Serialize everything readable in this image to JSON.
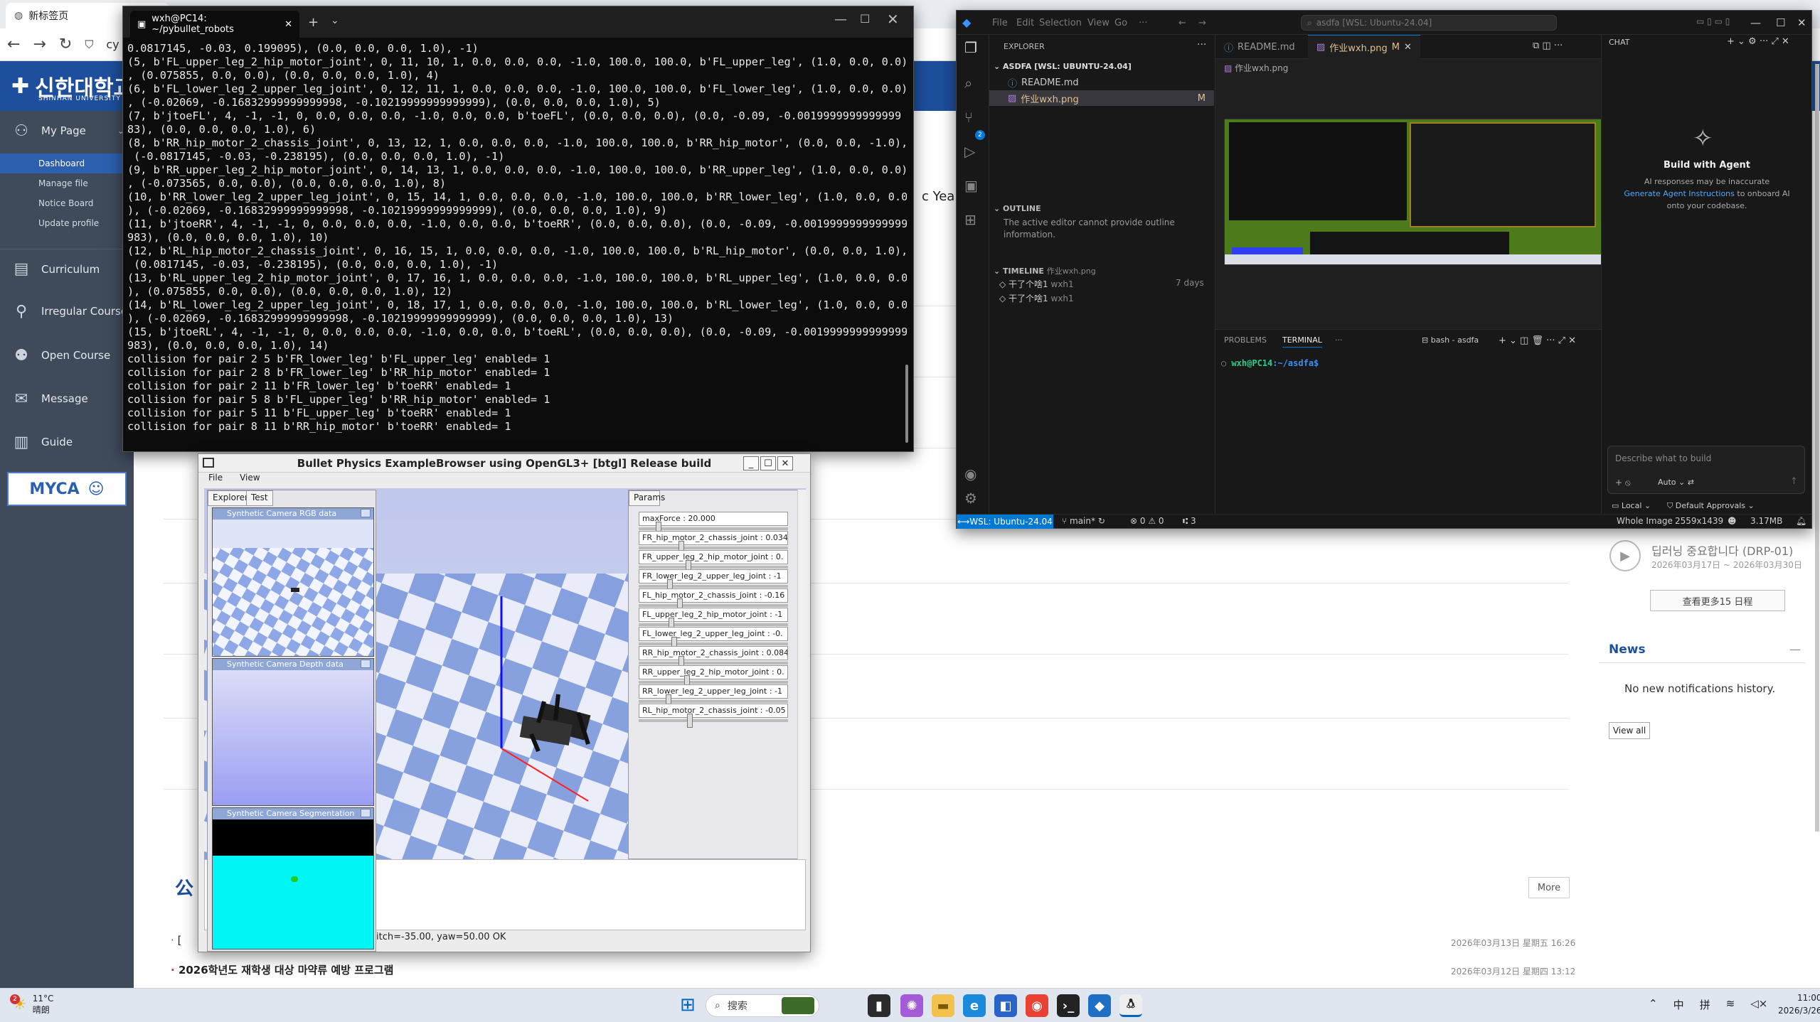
{
  "browser": {
    "tab_title": "新标签页",
    "url_fragment": "cy"
  },
  "portal": {
    "logo_text": "신한대학교",
    "logo_sub": "SHINHAN UNIVERSITY",
    "nav": [
      {
        "label": "My Page",
        "icon": "person-icon"
      },
      {
        "label": "Curriculum",
        "icon": "book-icon"
      },
      {
        "label": "Irregular Course",
        "icon": "person-run-icon"
      },
      {
        "label": "Open Course",
        "icon": "group-icon"
      },
      {
        "label": "Message",
        "icon": "mail-icon"
      },
      {
        "label": "Guide",
        "icon": "guide-icon"
      }
    ],
    "sub_nav": [
      "Dashboard",
      "Manage file",
      "Notice Board",
      "Update profile"
    ],
    "badge": "MYCA",
    "year_text": "c Year",
    "notice_heading": "公",
    "more_label": "More",
    "notices": [
      {
        "title": "[",
        "date": "2026年03月13日 星期五 16:26"
      },
      {
        "title": "2026학년도 재학생 대상 마약류 예방 프로그램",
        "date": "2026年03月12日 星期四 13:12"
      }
    ],
    "schedule_title": "딥러닝 중요합니다 (DRP-01)",
    "schedule_date": "2026年03月17日 ~ 2026年03月30日",
    "schedule_more": "查看更多15 日程",
    "news_title": "News",
    "news_empty": "No new notifications history.",
    "view_all": "View all"
  },
  "terminal": {
    "tab_title": "wxh@PC14: ~/pybullet_robots",
    "lines": [
      "0.0817145, -0.03, 0.199095), (0.0, 0.0, 0.0, 1.0), -1)",
      "(5, b'FL_upper_leg_2_hip_motor_joint', 0, 11, 10, 1, 0.0, 0.0, 0.0, -1.0, 100.0, 100.0, b'FL_upper_leg', (1.0, 0.0, 0.0)",
      ", (0.075855, 0.0, 0.0), (0.0, 0.0, 0.0, 1.0), 4)",
      "(6, b'FL_lower_leg_2_upper_leg_joint', 0, 12, 11, 1, 0.0, 0.0, 0.0, -1.0, 100.0, 100.0, b'FL_lower_leg', (1.0, 0.0, 0.0)",
      ", (-0.02069, -0.16832999999999998, -0.10219999999999999), (0.0, 0.0, 0.0, 1.0), 5)",
      "(7, b'jtoeFL', 4, -1, -1, 0, 0.0, 0.0, 0.0, -1.0, 0.0, 0.0, b'toeFL', (0.0, 0.0, 0.0), (0.0, -0.09, -0.0019999999999999",
      "83), (0.0, 0.0, 0.0, 1.0), 6)",
      "(8, b'RR_hip_motor_2_chassis_joint', 0, 13, 12, 1, 0.0, 0.0, 0.0, -1.0, 100.0, 100.0, b'RR_hip_motor', (0.0, 0.0, -1.0),",
      " (-0.0817145, -0.03, -0.238195), (0.0, 0.0, 0.0, 1.0), -1)",
      "(9, b'RR_upper_leg_2_hip_motor_joint', 0, 14, 13, 1, 0.0, 0.0, 0.0, -1.0, 100.0, 100.0, b'RR_upper_leg', (1.0, 0.0, 0.0)",
      ", (-0.073565, 0.0, 0.0), (0.0, 0.0, 0.0, 1.0), 8)",
      "(10, b'RR_lower_leg_2_upper_leg_joint', 0, 15, 14, 1, 0.0, 0.0, 0.0, -1.0, 100.0, 100.0, b'RR_lower_leg', (1.0, 0.0, 0.0",
      "), (-0.02069, -0.16832999999999998, -0.10219999999999999), (0.0, 0.0, 0.0, 1.0), 9)",
      "(11, b'jtoeRR', 4, -1, -1, 0, 0.0, 0.0, 0.0, -1.0, 0.0, 0.0, b'toeRR', (0.0, 0.0, 0.0), (0.0, -0.09, -0.0019999999999999",
      "983), (0.0, 0.0, 0.0, 1.0), 10)",
      "(12, b'RL_hip_motor_2_chassis_joint', 0, 16, 15, 1, 0.0, 0.0, 0.0, -1.0, 100.0, 100.0, b'RL_hip_motor', (0.0, 0.0, 1.0),",
      " (0.0817145, -0.03, -0.238195), (0.0, 0.0, 0.0, 1.0), -1)",
      "(13, b'RL_upper_leg_2_hip_motor_joint', 0, 17, 16, 1, 0.0, 0.0, 0.0, -1.0, 100.0, 100.0, b'RL_upper_leg', (1.0, 0.0, 0.0",
      "), (0.075855, 0.0, 0.0), (0.0, 0.0, 0.0, 1.0), 12)",
      "(14, b'RL_lower_leg_2_upper_leg_joint', 0, 18, 17, 1, 0.0, 0.0, 0.0, -1.0, 100.0, 100.0, b'RL_lower_leg', (1.0, 0.0, 0.0",
      "), (-0.02069, -0.16832999999999998, -0.10219999999999999), (0.0, 0.0, 0.0, 1.0), 13)",
      "(15, b'jtoeRL', 4, -1, -1, 0, 0.0, 0.0, 0.0, -1.0, 0.0, 0.0, b'toeRL', (0.0, 0.0, 0.0), (0.0, -0.09, -0.0019999999999999",
      "983), (0.0, 0.0, 0.0, 1.0), 14)",
      "collision for pair 2 5 b'FR_lower_leg' b'FL_upper_leg' enabled= 1",
      "collision for pair 2 8 b'FR_lower_leg' b'RR_hip_motor' enabled= 1",
      "collision for pair 2 11 b'FR_lower_leg' b'toeRR' enabled= 1",
      "collision for pair 5 8 b'FL_upper_leg' b'RR_hip_motor' enabled= 1",
      "collision for pair 5 11 b'FL_upper_leg' b'toeRR' enabled= 1",
      "collision for pair 8 11 b'RR_hip_motor' b'toeRR' enabled= 1"
    ]
  },
  "bullet": {
    "title": "Bullet Physics ExampleBrowser using OpenGL3+ [btgl] Release build",
    "menu": [
      "File",
      "View"
    ],
    "tabs": [
      "Explorer",
      "Test"
    ],
    "cams": [
      "Synthetic Camera RGB data",
      "Synthetic Camera Depth data",
      "Synthetic Camera Segmentation Mask"
    ],
    "params_tab": "Params",
    "params": [
      "maxForce : 20.000",
      "FR_hip_motor_2_chassis_joint : 0.034",
      "FR_upper_leg_2_hip_motor_joint : 0.",
      "FR_lower_leg_2_upper_leg_joint : -1",
      "FL_hip_motor_2_chassis_joint : -0.16",
      "FL_upper_leg_2_hip_motor_joint : -1",
      "FL_lower_leg_2_upper_leg_joint : -0.",
      "RR_hip_motor_2_chassis_joint : 0.084",
      "RR_upper_leg_2_hip_motor_joint : 0.",
      "RR_lower_leg_2_upper_leg_joint : -1",
      "RL_hip_motor_2_chassis_joint : -0.05"
    ],
    "slider_positions": [
      0.12,
      0.28,
      0.33,
      0.2,
      0.27,
      0.21,
      0.23,
      0.28,
      0.32,
      0.19,
      0.34
    ],
    "status": "itch=-35.00, yaw=50.00 OK"
  },
  "vscode": {
    "menus": [
      "File",
      "Edit",
      "Selection",
      "View",
      "Go"
    ],
    "search": "asdfa [WSL: Ubuntu-24.04]",
    "explorer_title": "EXPLORER",
    "workspace": "ASDFA [WSL: UBUNTU-24.04]",
    "files": [
      {
        "name": "README.md",
        "badge": ""
      },
      {
        "name": "作业wxh.png",
        "badge": "M"
      }
    ],
    "outline_title": "OUTLINE",
    "outline_msg": "The active editor cannot provide outline information.",
    "timeline_title": "TIMELINE",
    "timeline_file": "作业wxh.png",
    "timeline": [
      {
        "msg": "干了个啥1",
        "author": "wxh1",
        "when": "7 days"
      },
      {
        "msg": "干了个啥1",
        "author": "wxh1",
        "when": ""
      }
    ],
    "tabs": [
      "README.md",
      "作业wxh.png"
    ],
    "tab_badge": "M",
    "breadcrumb": "作业wxh.png",
    "panel_tabs": [
      "PROBLEMS",
      "TERMINAL"
    ],
    "shell": "bash - asdfa",
    "prompt_user": "wxh@PC14",
    "prompt_path": ":~/asdfa$",
    "chat_title": "CHAT",
    "chat_heading": "Build with Agent",
    "chat_info": "AI responses may be inaccurate",
    "chat_link": "Generate Agent Instructions",
    "chat_info2": "to onboard AI",
    "chat_info3": "onto your codebase.",
    "chat_placeholder": "Describe what to build",
    "chat_mode": "Auto",
    "chat_local": "Local",
    "chat_approvals": "Default Approvals",
    "status_wsl": "WSL: Ubuntu-24.04",
    "status_branch": "main*",
    "status_errors": "0",
    "status_warnings": "0",
    "status_ports": "3",
    "status_image": "Whole Image",
    "status_dims": "2559x1439",
    "status_size": "3.17MB"
  },
  "taskbar": {
    "temp": "11°C",
    "weather": "晴朗",
    "weather_badge": "2",
    "search": "搜索",
    "ime1": "中",
    "ime2": "拼",
    "time": "11:00",
    "date": "2026/3/26"
  }
}
